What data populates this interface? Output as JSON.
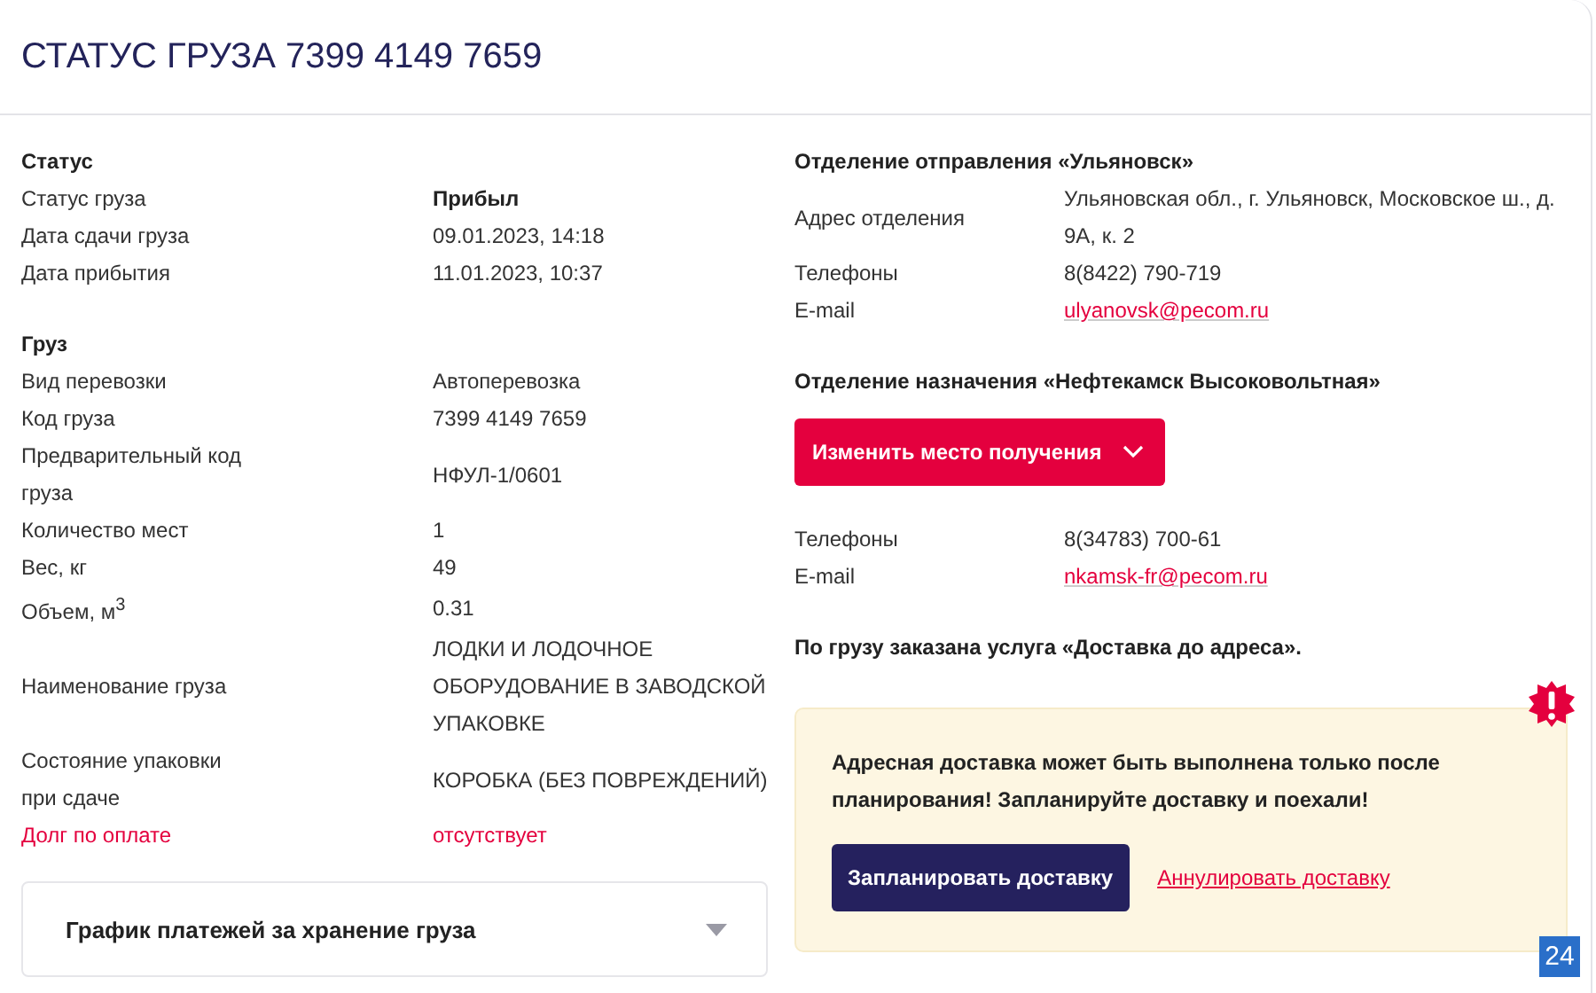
{
  "title": "СТАТУС ГРУЗА 7399 4149 7659",
  "status": {
    "heading": "Статус",
    "rows": [
      {
        "label": "Статус груза",
        "value": "Прибыл",
        "kind": "bold"
      },
      {
        "label": "Дата сдачи груза",
        "value": "09.01.2023, 14:18",
        "kind": "plain"
      },
      {
        "label": "Дата прибытия",
        "value": "11.01.2023, 10:37",
        "kind": "plain"
      }
    ]
  },
  "cargo": {
    "heading": "Груз",
    "rows": [
      {
        "label": "Вид перевозки",
        "value": "Автоперевозка",
        "kind": "plain"
      },
      {
        "label": "Код груза",
        "value": "7399 4149 7659",
        "kind": "plain"
      },
      {
        "label": "Предварительный код груза",
        "value": "НФУЛ-1/0601",
        "kind": "plain"
      },
      {
        "label": "Количество мест",
        "value": "1",
        "kind": "plain"
      },
      {
        "label": "Вес, кг",
        "value": "49",
        "kind": "plain"
      },
      {
        "label": "Объем, м$^{3}$",
        "value": "0.31",
        "kind": "plain"
      },
      {
        "label": "Наименование груза",
        "value": "ЛОДКИ И ЛОДОЧНОЕ ОБОРУДОВАНИЕ В ЗАВОДСКОЙ УПАКОВКЕ",
        "kind": "plain"
      },
      {
        "label": "Состояние упаковки при сдаче",
        "value": "КОРОБКА (БЕЗ ПОВРЕЖДЕНИЙ)",
        "kind": "plain"
      },
      {
        "label": "Долг по оплате",
        "value": "отсутствует",
        "kind": "alert"
      }
    ]
  },
  "payment_schedule": {
    "label": "График платежей за хранение груза",
    "expanded": false
  },
  "departure": {
    "heading": "Отделение отправления «Ульяновск»",
    "rows": [
      {
        "label": "Адрес отделения",
        "value": "Ульяновская обл., г. Ульяновск, Московское ш., д. 9А, к. 2",
        "kind": "plain"
      },
      {
        "label": "Телефоны",
        "value": "8(8422) 790-719",
        "kind": "plain"
      },
      {
        "label": "E-mail",
        "value": "ulyanovsk@pecom.ru",
        "kind": "link"
      }
    ]
  },
  "destination": {
    "heading": "Отделение назначения «Нефтекамск Высоковольтная»",
    "change_button": "Изменить место получения",
    "rows": [
      {
        "label": "Телефоны",
        "value": "8(34783) 700-61",
        "kind": "plain"
      },
      {
        "label": "E-mail",
        "value": "nkamsk-fr@pecom.ru",
        "kind": "link"
      }
    ]
  },
  "service_note": "По грузу заказана услуга «Доставка до адреса».",
  "notice": {
    "text": "Адресная доставка может быть выполнена только после планирования! Запланируйте доставку и поехали!",
    "primary_button": "Запланировать доставку",
    "cancel_link": "Аннулировать доставку"
  },
  "chat_widget": {
    "label": "24"
  }
}
